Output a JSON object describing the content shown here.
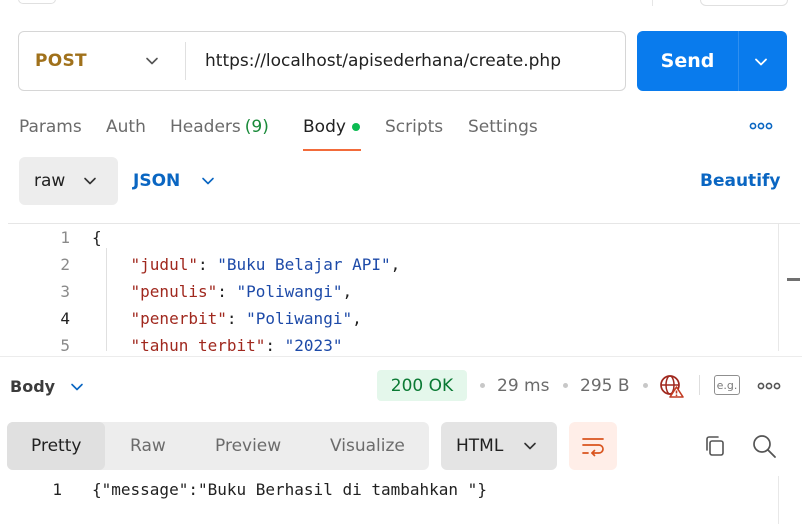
{
  "request": {
    "method": "POST",
    "url": "https://localhost/apisederhana/create.php",
    "send_label": "Send"
  },
  "tabs": {
    "params": "Params",
    "auth": "Auth",
    "headers": "Headers",
    "headers_count": "(9)",
    "body": "Body",
    "scripts": "Scripts",
    "settings": "Settings"
  },
  "body_options": {
    "mode": "raw",
    "language": "JSON",
    "beautify": "Beautify"
  },
  "editor": {
    "lines": [
      {
        "num": "1",
        "text": "{"
      },
      {
        "num": "2",
        "key": "\"judul\"",
        "value": "\"Buku Belajar API\""
      },
      {
        "num": "3",
        "key": "\"penulis\"",
        "value": "\"Poliwangi\""
      },
      {
        "num": "4",
        "key": "\"penerbit\"",
        "value": "\"Poliwangi\""
      },
      {
        "num": "5",
        "key": "\"tahun_terbit\"",
        "value": "\"2023\""
      }
    ]
  },
  "response": {
    "section_label": "Body",
    "status": "200 OK",
    "time": "29 ms",
    "size": "295 B",
    "eg_label": "e.g.",
    "views": [
      "Pretty",
      "Raw",
      "Preview",
      "Visualize"
    ],
    "active_view": "Pretty",
    "format": "HTML",
    "lines": [
      {
        "num": "1",
        "text": "{\"message\":\"Buku Berhasil di tambahkan \"}"
      }
    ]
  },
  "colors": {
    "accent_blue": "#097bed",
    "method_post": "#a0711b",
    "status_green": "#0b7a34",
    "tab_underline": "#f26b3a"
  }
}
